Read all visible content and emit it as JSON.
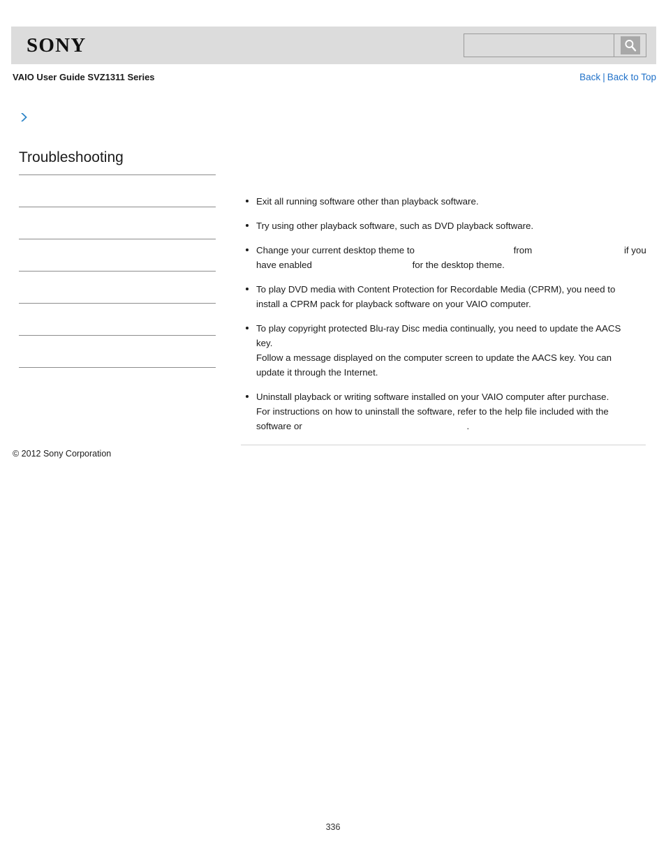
{
  "header": {
    "logo_text": "SONY",
    "search": {
      "value": "",
      "placeholder": "",
      "button_icon": "search-icon",
      "button_label": "Search"
    }
  },
  "breadcrumb": {
    "doc_title": "VAIO User Guide SVZ1311 Series",
    "back_label": "Back",
    "separator": "|",
    "back_to_top_label": "Back to Top"
  },
  "sidebar": {
    "arrow_icon": "chevron-right-icon",
    "section_title": "Troubleshooting",
    "items": [
      {
        "label": ""
      },
      {
        "label": ""
      },
      {
        "label": ""
      },
      {
        "label": ""
      },
      {
        "label": ""
      },
      {
        "label": ""
      }
    ]
  },
  "main": {
    "bullets": [
      {
        "lines": [
          {
            "segments": [
              {
                "text": "Exit all running software other than playback software."
              }
            ]
          }
        ]
      },
      {
        "lines": [
          {
            "segments": [
              {
                "text": "Try using other playback software, such as DVD playback software."
              }
            ]
          }
        ]
      },
      {
        "lines": [
          {
            "segments": [
              {
                "text": "Change your current desktop theme to"
              },
              {
                "text": "",
                "gap": 138
              },
              {
                "text": "from"
              },
              {
                "text": "",
                "gap": 128
              },
              {
                "text": "if you"
              }
            ]
          },
          {
            "segments": [
              {
                "text": "have enabled"
              },
              {
                "text": "",
                "gap": 140
              },
              {
                "text": "for the desktop theme."
              }
            ]
          }
        ]
      },
      {
        "lines": [
          {
            "segments": [
              {
                "text": "To play DVD media with Content Protection for Recordable Media (CPRM), you need to"
              }
            ]
          },
          {
            "segments": [
              {
                "text": "install a CPRM pack for playback software on your VAIO computer."
              }
            ]
          }
        ]
      },
      {
        "lines": [
          {
            "segments": [
              {
                "text": "To play copyright protected Blu-ray Disc media continually, you need to update the AACS"
              }
            ]
          },
          {
            "segments": [
              {
                "text": "key."
              }
            ]
          },
          {
            "segments": [
              {
                "text": "Follow a message displayed on the computer screen to update the AACS key. You can"
              }
            ]
          },
          {
            "segments": [
              {
                "text": "update it through the Internet."
              }
            ]
          }
        ]
      },
      {
        "lines": [
          {
            "segments": [
              {
                "text": "Uninstall playback or writing software installed on your VAIO computer after purchase."
              }
            ]
          },
          {
            "segments": [
              {
                "text": "For instructions on how to uninstall the software, refer to the help file included with the"
              }
            ]
          },
          {
            "segments": [
              {
                "text": "software or"
              },
              {
                "text": "",
                "gap": 232
              },
              {
                "text": "."
              }
            ]
          }
        ]
      }
    ]
  },
  "footer": {
    "copyright": "© 2012 Sony Corporation",
    "page_number": "336"
  },
  "colors": {
    "header_bg": "#dcdcdc",
    "link_blue": "#2172c9",
    "accent_blue": "#2f86c8",
    "rule_gray": "#8c8c8c",
    "page_bg": "#ffffff"
  }
}
